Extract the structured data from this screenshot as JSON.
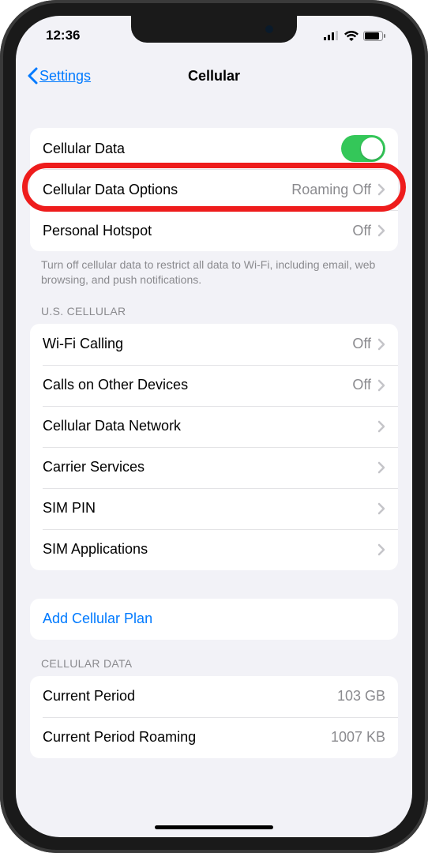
{
  "status": {
    "time": "12:36"
  },
  "nav": {
    "back_label": "Settings",
    "title": "Cellular"
  },
  "group1": {
    "rows": [
      {
        "label": "Cellular Data"
      },
      {
        "label": "Cellular Data Options",
        "value": "Roaming Off"
      },
      {
        "label": "Personal Hotspot",
        "value": "Off"
      }
    ],
    "footer": "Turn off cellular data to restrict all data to Wi-Fi, including email, web browsing, and push notifications."
  },
  "group2": {
    "header": "U.S. CELLULAR",
    "rows": [
      {
        "label": "Wi-Fi Calling",
        "value": "Off"
      },
      {
        "label": "Calls on Other Devices",
        "value": "Off"
      },
      {
        "label": "Cellular Data Network"
      },
      {
        "label": "Carrier Services"
      },
      {
        "label": "SIM PIN"
      },
      {
        "label": "SIM Applications"
      }
    ]
  },
  "group3": {
    "rows": [
      {
        "label": "Add Cellular Plan"
      }
    ]
  },
  "group4": {
    "header": "CELLULAR DATA",
    "rows": [
      {
        "label": "Current Period",
        "value": "103 GB"
      },
      {
        "label": "Current Period Roaming",
        "value": "1007 KB"
      }
    ]
  }
}
